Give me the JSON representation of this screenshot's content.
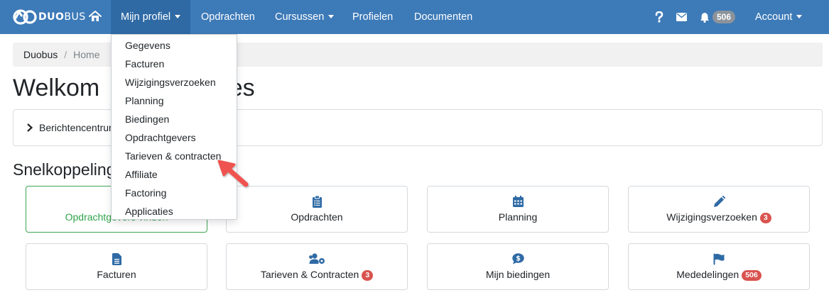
{
  "navbar": {
    "brand": {
      "name_bold": "DUO",
      "name_thin": "BUS"
    },
    "menu": [
      {
        "label": "Mijn profiel",
        "has_caret": true,
        "active": true
      },
      {
        "label": "Opdrachten",
        "has_caret": false
      },
      {
        "label": "Cursussen",
        "has_caret": true
      },
      {
        "label": "Profielen",
        "has_caret": false
      },
      {
        "label": "Documenten",
        "has_caret": false
      }
    ],
    "help_icon": "question-icon",
    "mail_icon": "envelope-icon",
    "notification_count": "506",
    "account_label": "Account"
  },
  "breadcrumb": {
    "items": [
      "Duobus",
      "Home"
    ],
    "separator": "/"
  },
  "page_title": {
    "left": "Welkom",
    "right": "Kees"
  },
  "message_center": {
    "label": "Berichtencentrum"
  },
  "section_title": "Snelkoppelingen",
  "dropdown": {
    "items": [
      "Gegevens",
      "Facturen",
      "Wijzigingsverzoeken",
      "Planning",
      "Biedingen",
      "Opdrachtgevers",
      "Tarieven & contracten",
      "Affiliate",
      "Factoring",
      "Applicaties"
    ]
  },
  "tiles": [
    {
      "label": "Opdrachtgevers vinden",
      "icon": "search-icon",
      "badge": null,
      "highlight": true
    },
    {
      "label": "Opdrachten",
      "icon": "clipboard-icon",
      "badge": null
    },
    {
      "label": "Planning",
      "icon": "calendar-icon",
      "badge": null
    },
    {
      "label": "Wijzigingsverzoeken",
      "icon": "pencil-icon",
      "badge": "3"
    },
    {
      "label": "Facturen",
      "icon": "file-icon",
      "badge": null
    },
    {
      "label": "Tarieven & Contracten",
      "icon": "users-cog-icon",
      "badge": "3"
    },
    {
      "label": "Mijn biedingen",
      "icon": "dollar-bubble-icon",
      "badge": null
    },
    {
      "label": "Mededelingen",
      "icon": "flag-icon",
      "badge": "506"
    }
  ],
  "colors": {
    "navbar": "#3d7ab8",
    "navbar_active": "#2f6aa5",
    "highlight_green": "#2fa34a",
    "icon_blue": "#2f6aa5",
    "badge_red": "#d9534f",
    "arrow_red": "#ef5350"
  }
}
